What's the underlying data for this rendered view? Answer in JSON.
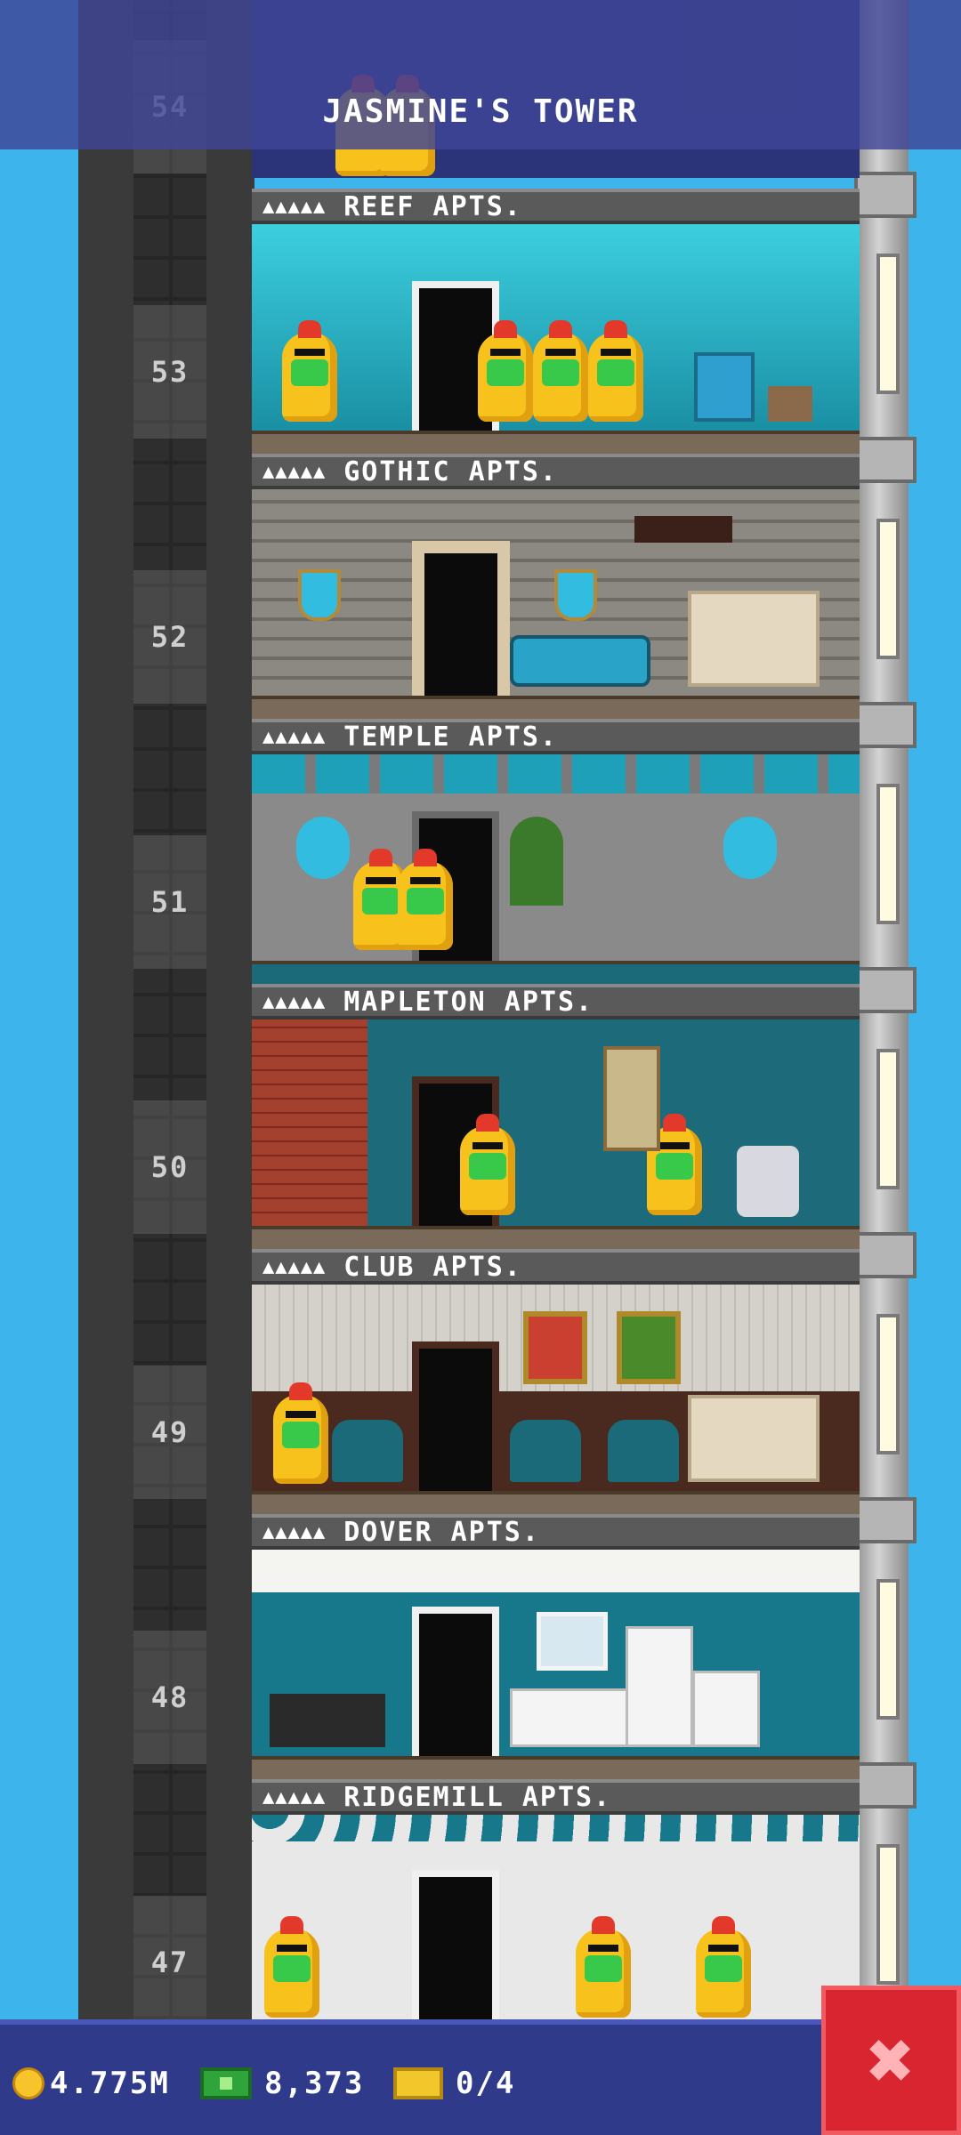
{
  "tower": {
    "title": "JASMINE'S TOWER"
  },
  "resident_icons": "▲▲▲▲▲",
  "top_floor": {
    "number": "54"
  },
  "floors": [
    {
      "number": "53",
      "name": "REEF APTS.",
      "theme": "#1f8fa3"
    },
    {
      "number": "52",
      "name": "GOTHIC APTS.",
      "theme": "#8c8983"
    },
    {
      "number": "51",
      "name": "TEMPLE APTS.",
      "theme": "#7a7a7a"
    },
    {
      "number": "50",
      "name": "MAPLETON APTS.",
      "theme": "#1d6b7a"
    },
    {
      "number": "49",
      "name": "CLUB APTS.",
      "theme": "#c9c6c0"
    },
    {
      "number": "48",
      "name": "DOVER APTS.",
      "theme": "#17788c"
    },
    {
      "number": "47",
      "name": "RIDGEMILL APTS.",
      "theme": "#e8e8e8"
    }
  ],
  "status_bar": {
    "coins": "4.775M",
    "tower_bux": "8,373",
    "tickets": "0/4"
  },
  "icons": {
    "coin": "coin-icon",
    "bux": "bux-icon",
    "ticket": "ticket-icon",
    "close": "close-icon"
  },
  "close_label": "✖"
}
